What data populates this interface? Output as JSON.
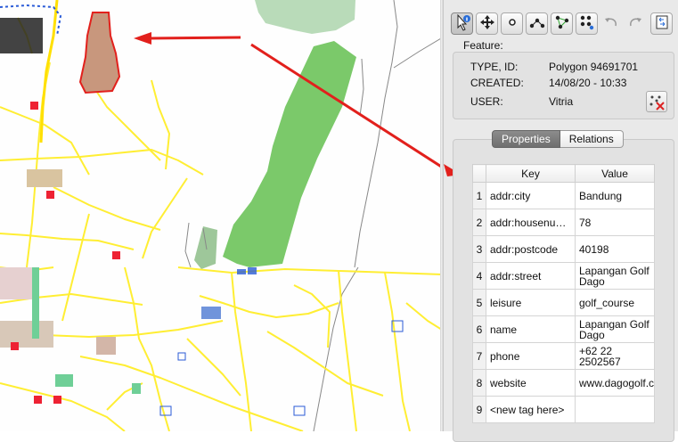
{
  "toolbar": {
    "buttons": [
      {
        "icon": "select-info-icon",
        "active": true
      },
      {
        "icon": "move-icon"
      },
      {
        "icon": "node-icon"
      },
      {
        "icon": "way-icon"
      },
      {
        "icon": "closed-way-icon"
      },
      {
        "icon": "area-icon"
      },
      {
        "icon": "undo-icon"
      },
      {
        "icon": "redo-icon"
      },
      {
        "icon": "download-icon"
      }
    ]
  },
  "feature": {
    "title": "Feature:",
    "type_label": "TYPE, ID:",
    "type_value": "Polygon  94691701",
    "created_label": "CREATED:",
    "created_value": "14/08/20 - 10:33",
    "user_label": "USER:",
    "user_value": "Vitria"
  },
  "tabs": [
    "Properties",
    "Relations"
  ],
  "table": {
    "headers": [
      "Key",
      "Value"
    ],
    "rows": [
      {
        "n": "1",
        "key": "addr:city",
        "value": "Bandung"
      },
      {
        "n": "2",
        "key": "addr:housenumber",
        "value": "78"
      },
      {
        "n": "3",
        "key": "addr:postcode",
        "value": "40198"
      },
      {
        "n": "4",
        "key": "addr:street",
        "value": "Lapangan Golf Dago"
      },
      {
        "n": "5",
        "key": "leisure",
        "value": "golf_course"
      },
      {
        "n": "6",
        "key": "name",
        "value": "Lapangan Golf Dago"
      },
      {
        "n": "7",
        "key": "phone",
        "value": "+62 22 2502567"
      },
      {
        "n": "8",
        "key": "website",
        "value": "www.dagogolf.com"
      },
      {
        "n": "9",
        "key": "<new tag here>",
        "value": ""
      }
    ]
  },
  "colors": {
    "road": "#ffee33",
    "golf_green": "#7bc96a",
    "golf_light": "#b9dbb9",
    "selected_fill": "#c8977d",
    "selected_outline": "#e2201c",
    "arrow": "#e2201c"
  }
}
